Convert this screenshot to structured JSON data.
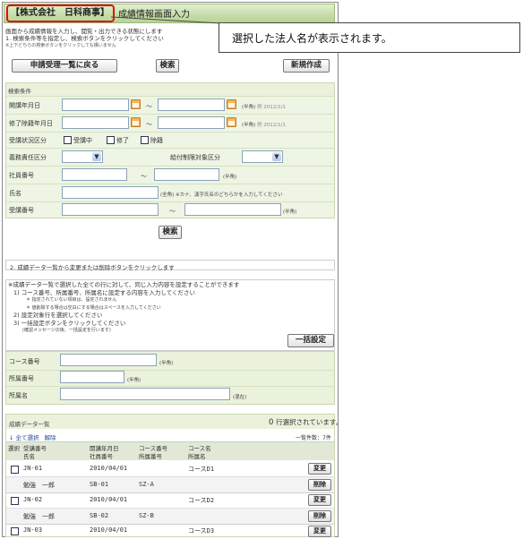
{
  "header": {
    "company": "【株式会社　日科商事】",
    "title": "成績情報画面入力"
  },
  "callout": {
    "text": "選択した法人名が表示されます。"
  },
  "intro": {
    "line1": "画面から成績情報を入力し、閲覧・出力できる状態にします",
    "line2": "1. 検索条件等を指定し、検索ボタンをクリックしてください",
    "line3": "※上下どちらの検索ボタンをクリックしても構いません"
  },
  "toolbar": {
    "back": "申請受理一覧に戻る",
    "search": "検索",
    "create": "新規作成"
  },
  "search": {
    "section_title": "検索条件",
    "start_date": {
      "label": "開講年月日",
      "hint": "(半角)",
      "example": "例 2012/1/1"
    },
    "end_date": {
      "label": "修了除籍年月日",
      "hint": "(半角)",
      "example": "例 2012/1/1"
    },
    "status": {
      "label": "受講状況区分",
      "options": [
        "受講中",
        "修了",
        "除籍"
      ]
    },
    "duty": {
      "label": "義務責任区分"
    },
    "pay": {
      "label": "給付制限対象区分"
    },
    "emp_no": {
      "label": "社員番号",
      "hint": "(半角)"
    },
    "name": {
      "label": "氏名",
      "hint": "(全角) ※カナ、漢字氏名のどちらかを入力してください"
    },
    "student_no": {
      "label": "受講番号",
      "hint": "(半角)"
    },
    "tilde": "～",
    "search_button": "検索"
  },
  "step2": {
    "text": "2. 成績データ一覧から変更または削除ボタンをクリックします"
  },
  "bulk": {
    "line1": "※成績データ一覧で選択した全ての行に対して、同じ入力内容を設定することができます",
    "line2": "1) コース番号、所属番号、所属名に設定する内容を入力してください",
    "line3": "＊ 指定されていない項目は、設定されません",
    "line4": "＊ 値削除する場合は空白にする場合はスペースを入力してください",
    "line5": "2) 設定対象行を選択してください",
    "line6": "3) 一括設定ボタンをクリックしてください",
    "line7": "(確認メッセージの後、一括設定を行います)",
    "button": "一括設定",
    "course_label": "コース番号",
    "course_hint": "(半角)",
    "dept_no_label": "所属番号",
    "dept_no_hint": "(半角)",
    "dept_name_label": "所属名",
    "dept_name_hint": "(混在)"
  },
  "grid": {
    "title": "成績データ一覧",
    "selected_count": "0",
    "selected_text": "行選択されています。",
    "select_all": "全て選択",
    "deselect": "解除",
    "total": "一覧件数：7件",
    "header1": [
      "選択",
      "受講番号",
      "開講年月日",
      "コース番号",
      "コース名"
    ],
    "header2": [
      "氏名",
      "社員番号",
      "所属番号",
      "所属名"
    ],
    "rows": [
      {
        "no": "JN-01",
        "date": "2010/04/01",
        "course": "",
        "cname": "コースD1",
        "name": "勉強　一郎",
        "emp": "SB-01",
        "dept": "SZ-A",
        "dname": ""
      },
      {
        "no": "JN-02",
        "date": "2010/04/01",
        "course": "",
        "cname": "コースD2",
        "name": "勉強　一郎",
        "emp": "SB-02",
        "dept": "SZ-B",
        "dname": ""
      },
      {
        "no": "JN-03",
        "date": "2010/04/01",
        "course": "",
        "cname": "コースD3",
        "name": "",
        "emp": "",
        "dept": "",
        "dname": ""
      }
    ],
    "edit": "変更",
    "delete": "削除"
  }
}
